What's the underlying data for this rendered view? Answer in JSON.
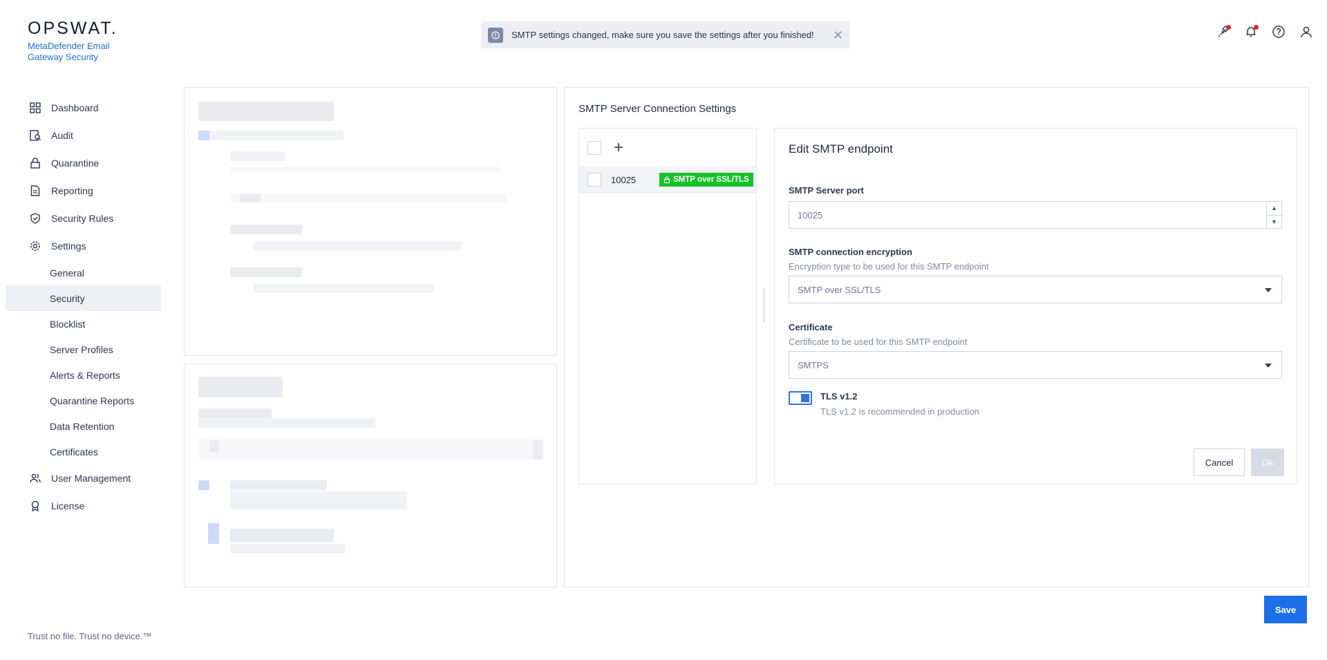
{
  "header": {
    "brand": "OPSWAT.",
    "product": "MetaDefender Email Gateway Security",
    "banner_text": "SMTP settings changed, make sure you save the settings after you finished!",
    "icons": [
      "plug-icon",
      "bell-icon",
      "help-icon",
      "user-icon"
    ]
  },
  "sidebar": {
    "items": [
      {
        "label": "Dashboard",
        "icon": "dashboard-icon"
      },
      {
        "label": "Audit",
        "icon": "audit-icon"
      },
      {
        "label": "Quarantine",
        "icon": "lock-icon"
      },
      {
        "label": "Reporting",
        "icon": "document-icon"
      },
      {
        "label": "Security Rules",
        "icon": "shield-check-icon"
      },
      {
        "label": "Settings",
        "icon": "gear-icon"
      }
    ],
    "settings_sub": [
      {
        "label": "General"
      },
      {
        "label": "Security",
        "active": true
      },
      {
        "label": "Blocklist"
      },
      {
        "label": "Server Profiles"
      },
      {
        "label": "Alerts & Reports"
      },
      {
        "label": "Quarantine Reports"
      },
      {
        "label": "Data Retention"
      },
      {
        "label": "Certificates"
      }
    ],
    "bottom_items": [
      {
        "label": "User Management",
        "icon": "users-icon"
      },
      {
        "label": "License",
        "icon": "badge-icon"
      }
    ],
    "footer": "Trust no file. Trust no device.™"
  },
  "smtp": {
    "title": "SMTP Server Connection Settings",
    "list": [
      {
        "port": "10025",
        "badge": "SMTP over SSL/TLS"
      }
    ],
    "edit": {
      "title": "Edit SMTP endpoint",
      "port_label": "SMTP Server port",
      "port_value": "10025",
      "encryption_label": "SMTP connection encryption",
      "encryption_help": "Encryption type to be used for this SMTP endpoint",
      "encryption_value": "SMTP over SSL/TLS",
      "certificate_label": "Certificate",
      "certificate_help": "Certificate to be used for this SMTP endpoint",
      "certificate_value": "SMTPS",
      "tls_label": "TLS v1.2",
      "tls_help": "TLS v1.2 is recommended in production",
      "tls_enabled": true,
      "cancel": "Cancel",
      "ok": "Ok"
    }
  },
  "save": "Save",
  "colors": {
    "accent": "#1d6fe9",
    "badge_green": "#16c12a",
    "notification_red": "#e0262b"
  }
}
